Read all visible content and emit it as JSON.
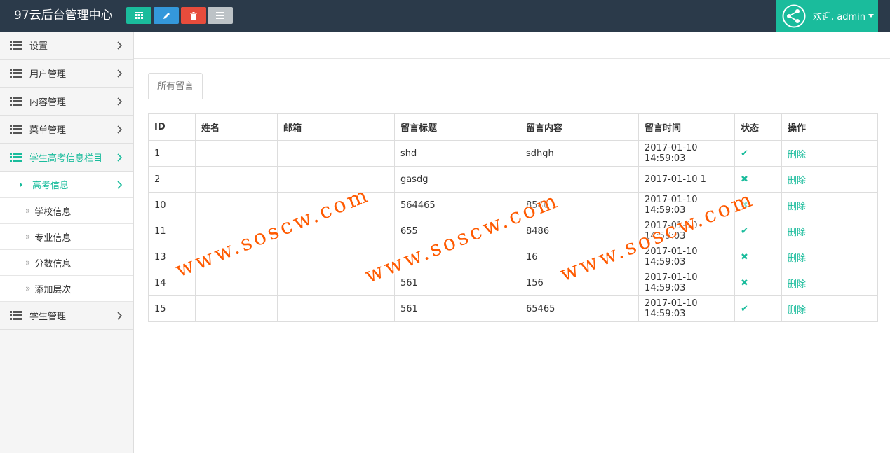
{
  "header": {
    "title": "97云后台管理中心",
    "user_label": "欢迎, admin",
    "toolbar": [
      {
        "icon": "table-icon",
        "color": "#1abc9c"
      },
      {
        "icon": "pencil-icon",
        "color": "#3498db"
      },
      {
        "icon": "trash-icon",
        "color": "#e74c3c"
      },
      {
        "icon": "list-icon",
        "color": "#bdc3c7"
      }
    ]
  },
  "sidebar": {
    "items": [
      {
        "label": "设置"
      },
      {
        "label": "用户管理"
      },
      {
        "label": "内容管理"
      },
      {
        "label": "菜单管理"
      },
      {
        "label": "学生高考信息栏目"
      },
      {
        "label": "学生管理"
      }
    ],
    "subitems": [
      {
        "label": "高考信息"
      },
      {
        "label": "学校信息"
      },
      {
        "label": "专业信息"
      },
      {
        "label": "分数信息"
      },
      {
        "label": "添加层次"
      }
    ]
  },
  "main": {
    "tab_label": "所有留言",
    "columns": [
      "ID",
      "姓名",
      "邮箱",
      "留言标题",
      "留言内容",
      "留言时间",
      "状态",
      "操作"
    ],
    "rows": [
      {
        "id": "1",
        "name": "",
        "email": "",
        "title": "shd",
        "content": "sdhgh",
        "time": "2017-01-10 14:59:03",
        "status": "check",
        "action": "删除"
      },
      {
        "id": "2",
        "name": "",
        "email": "",
        "title": "gasdg",
        "content": "",
        "time": "2017-01-10 1",
        "status": "cross",
        "action": "删除"
      },
      {
        "id": "10",
        "name": "",
        "email": "",
        "title": "564465",
        "content": "8546",
        "time": "2017-01-10 14:59:03",
        "status": "cross",
        "action": "删除"
      },
      {
        "id": "11",
        "name": "",
        "email": "",
        "title": "655",
        "content": "8486",
        "time": "2017-01-10 14:59:03",
        "status": "check",
        "action": "删除"
      },
      {
        "id": "13",
        "name": "",
        "email": "",
        "title": "",
        "content": "16",
        "time": "2017-01-10 14:59:03",
        "status": "cross",
        "action": "删除"
      },
      {
        "id": "14",
        "name": "",
        "email": "",
        "title": "561",
        "content": "156",
        "time": "2017-01-10 14:59:03",
        "status": "cross",
        "action": "删除"
      },
      {
        "id": "15",
        "name": "",
        "email": "",
        "title": "561",
        "content": "65465",
        "time": "2017-01-10 14:59:03",
        "status": "check",
        "action": "删除"
      }
    ]
  },
  "watermark": "www.soscw.com",
  "colors": {
    "accent": "#1abc9c",
    "header_bg": "#2b3a4a",
    "watermark": "#ff5a00"
  }
}
